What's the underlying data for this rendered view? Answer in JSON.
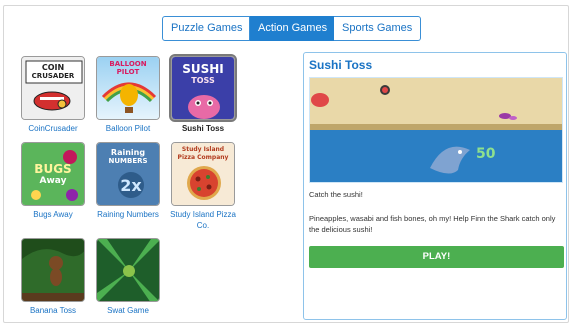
{
  "tabs": [
    {
      "label": "Puzzle Games",
      "active": false
    },
    {
      "label": "Action Games",
      "active": true
    },
    {
      "label": "Sports Games",
      "active": false
    }
  ],
  "games": [
    {
      "label": "CoinCrusader",
      "thumb_text": [
        "COIN",
        "CRUSADER"
      ]
    },
    {
      "label": "Balloon Pilot",
      "thumb_text": [
        "BALLOON",
        "PILOT"
      ]
    },
    {
      "label": "Sushi Toss",
      "thumb_text": [
        "SUSHI",
        "TOSS"
      ]
    },
    {
      "label": "Bugs Away",
      "thumb_text": [
        "BUGS",
        "Away"
      ]
    },
    {
      "label": "Raining Numbers",
      "thumb_text": [
        "Raining",
        "NUMBERS"
      ]
    },
    {
      "label": "Study Island Pizza Co.",
      "thumb_text": [
        "Study Island",
        "Pizza Company"
      ]
    },
    {
      "label": "Banana Toss",
      "thumb_text": []
    },
    {
      "label": "Swat Game",
      "thumb_text": []
    }
  ],
  "selected_game": "Sushi Toss",
  "detail": {
    "title": "Sushi Toss",
    "tagline": "Catch the sushi!",
    "description": "Pineapples, wasabi and fish bones, oh my! Help Finn the Shark catch only the delicious sushi!",
    "play_label": "PLAY!",
    "preview_score": "50"
  },
  "colors": {
    "accent": "#1f7fcf",
    "link": "#1a73c4",
    "play": "#4caf50",
    "panel_border": "#8ec3ea"
  }
}
